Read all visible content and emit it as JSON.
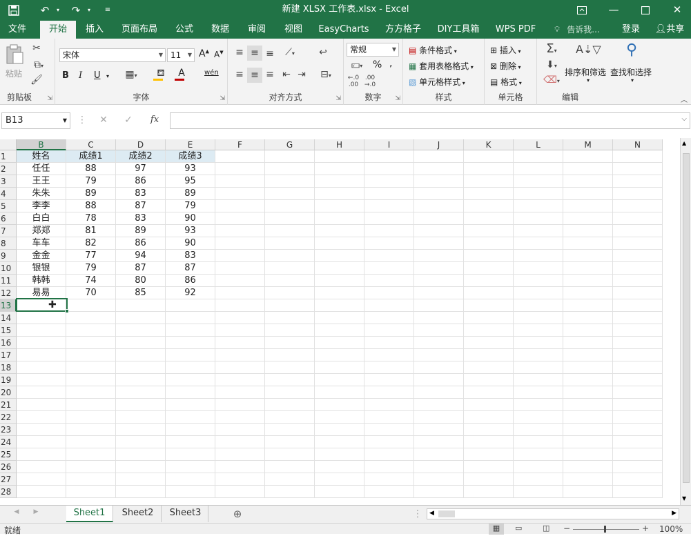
{
  "titlebar": {
    "title": "新建 XLSX 工作表.xlsx - Excel",
    "save_icon": "floppy-icon",
    "undo_icon": "undo-icon",
    "redo_icon": "redo-icon",
    "customize_icon": "customize-icon",
    "ribbon_display_icon": "ribbon-display-icon",
    "minimize_icon": "minimize-icon",
    "restore_icon": "restore-icon",
    "close_icon": "close-icon"
  },
  "tabs": [
    {
      "label": "文件"
    },
    {
      "label": "开始"
    },
    {
      "label": "插入"
    },
    {
      "label": "页面布局"
    },
    {
      "label": "公式"
    },
    {
      "label": "数据"
    },
    {
      "label": "审阅"
    },
    {
      "label": "视图"
    },
    {
      "label": "EasyCharts"
    },
    {
      "label": "方方格子"
    },
    {
      "label": "DIY工具箱"
    },
    {
      "label": "WPS PDF"
    },
    {
      "label": "告诉我..."
    },
    {
      "label": "登录"
    },
    {
      "label": "共享"
    }
  ],
  "ribbon": {
    "clipboard": {
      "paste": "粘贴",
      "label": "剪贴板"
    },
    "font": {
      "name": "宋体",
      "size": "11",
      "bold": "B",
      "italic": "I",
      "underline": "U",
      "phonetic": "wén",
      "label": "字体",
      "grow": "A",
      "shrink": "A",
      "color_letter": "A"
    },
    "align": {
      "label": "对齐方式"
    },
    "number": {
      "format": "常规",
      "percent": "%",
      "comma": ",",
      "label": "数字"
    },
    "styles": {
      "conditional": "条件格式",
      "table": "套用表格格式",
      "cell": "单元格样式",
      "label": "样式"
    },
    "cells": {
      "insert": "插入",
      "delete": "删除",
      "format": "格式",
      "label": "单元格"
    },
    "editing": {
      "sort": "排序和筛选",
      "find": "查找和选择",
      "label": "编辑"
    },
    "colors": {
      "accent": "#217346",
      "font_color": "#c00000",
      "fill_color": "#ffc000"
    }
  },
  "formula_bar": {
    "name_box": "B13",
    "fx": "fx",
    "value": ""
  },
  "columns": [
    "B",
    "C",
    "D",
    "E",
    "F",
    "G",
    "H",
    "I",
    "J",
    "K",
    "L",
    "M",
    "N"
  ],
  "rows": [
    "1",
    "2",
    "3",
    "4",
    "5",
    "6",
    "7",
    "8",
    "9",
    "10",
    "11",
    "12",
    "13",
    "14",
    "15",
    "16",
    "17",
    "18",
    "19",
    "20",
    "21",
    "22",
    "23",
    "24",
    "25",
    "26",
    "27",
    "28"
  ],
  "table": {
    "header": [
      "姓名",
      "成绩1",
      "成绩2",
      "成绩3"
    ],
    "rows": [
      [
        "任任",
        "88",
        "97",
        "93"
      ],
      [
        "王王",
        "79",
        "86",
        "95"
      ],
      [
        "朱朱",
        "89",
        "83",
        "89"
      ],
      [
        "李李",
        "88",
        "87",
        "79"
      ],
      [
        "白白",
        "78",
        "83",
        "90"
      ],
      [
        "郑郑",
        "81",
        "89",
        "93"
      ],
      [
        "车车",
        "82",
        "86",
        "90"
      ],
      [
        "金金",
        "77",
        "94",
        "83"
      ],
      [
        "银银",
        "79",
        "87",
        "87"
      ],
      [
        "韩韩",
        "74",
        "80",
        "86"
      ],
      [
        "易易",
        "70",
        "85",
        "92"
      ]
    ]
  },
  "selected_cell": "B13",
  "sheets": [
    {
      "label": "Sheet1"
    },
    {
      "label": "Sheet2"
    },
    {
      "label": "Sheet3"
    }
  ],
  "active_sheet": "Sheet1",
  "status": {
    "mode": "就绪",
    "zoom": "100%"
  }
}
